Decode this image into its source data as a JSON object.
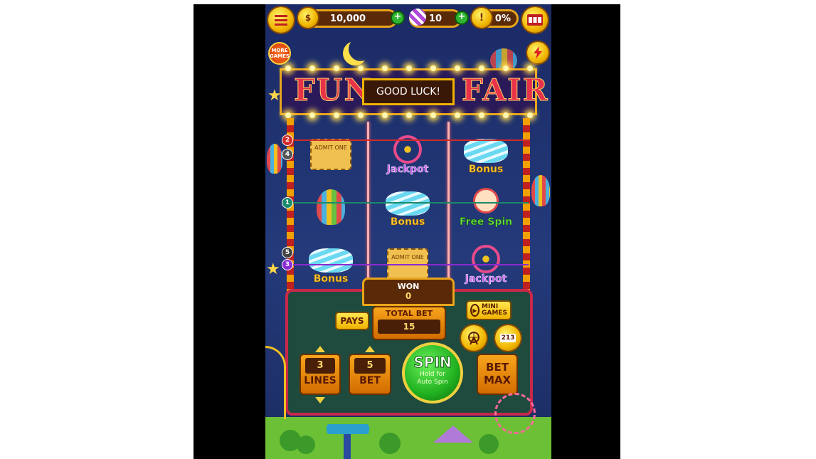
{
  "topbar": {
    "coins": "10,000",
    "gems": "10",
    "level_percent": "0%",
    "coin_symbol": "$",
    "plus": "+"
  },
  "left_buttons": {
    "more_games": "MORE GAMES"
  },
  "banner": {
    "left_word": "FUN",
    "right_word": "FAIR",
    "message": "GOOD LUCK!"
  },
  "reels": {
    "symbols": [
      {
        "name": "admit-one-ticket",
        "label": "",
        "ticket_text": "ADMIT ONE"
      },
      {
        "name": "jackpot-ferris",
        "label": "Jackpot"
      },
      {
        "name": "bonus-candy",
        "label": "Bonus"
      },
      {
        "name": "hot-air-balloon",
        "label": ""
      },
      {
        "name": "bonus-candy",
        "label": "Bonus"
      },
      {
        "name": "clown-freespin",
        "label": "Free Spin"
      },
      {
        "name": "bonus-candy",
        "label": "Bonus"
      },
      {
        "name": "admit-one-ticket",
        "label": "",
        "ticket_text": "ADMIT ONE"
      },
      {
        "name": "jackpot-ferris",
        "label": "Jackpot"
      }
    ]
  },
  "paylines": [
    {
      "num": "2",
      "color": "#d02a2a"
    },
    {
      "num": "4",
      "color": "#555555"
    },
    {
      "num": "1",
      "color": "#1a8a6a"
    },
    {
      "num": "5",
      "color": "#444444"
    },
    {
      "num": "3",
      "color": "#8a2ad0"
    }
  ],
  "controls": {
    "won_label": "WON",
    "won_value": "0",
    "pays_label": "PAYS",
    "total_bet_label": "TOTAL BET",
    "total_bet_value": "15",
    "mini_games_label": "MINI GAMES",
    "lines_value": "3",
    "lines_label": "LINES",
    "bet_value": "5",
    "bet_label": "BET",
    "spin_label": "SPIN",
    "spin_sub": "Hold for Auto Spin",
    "bet_max_label": "BET MAX",
    "podium_digits": "213"
  }
}
